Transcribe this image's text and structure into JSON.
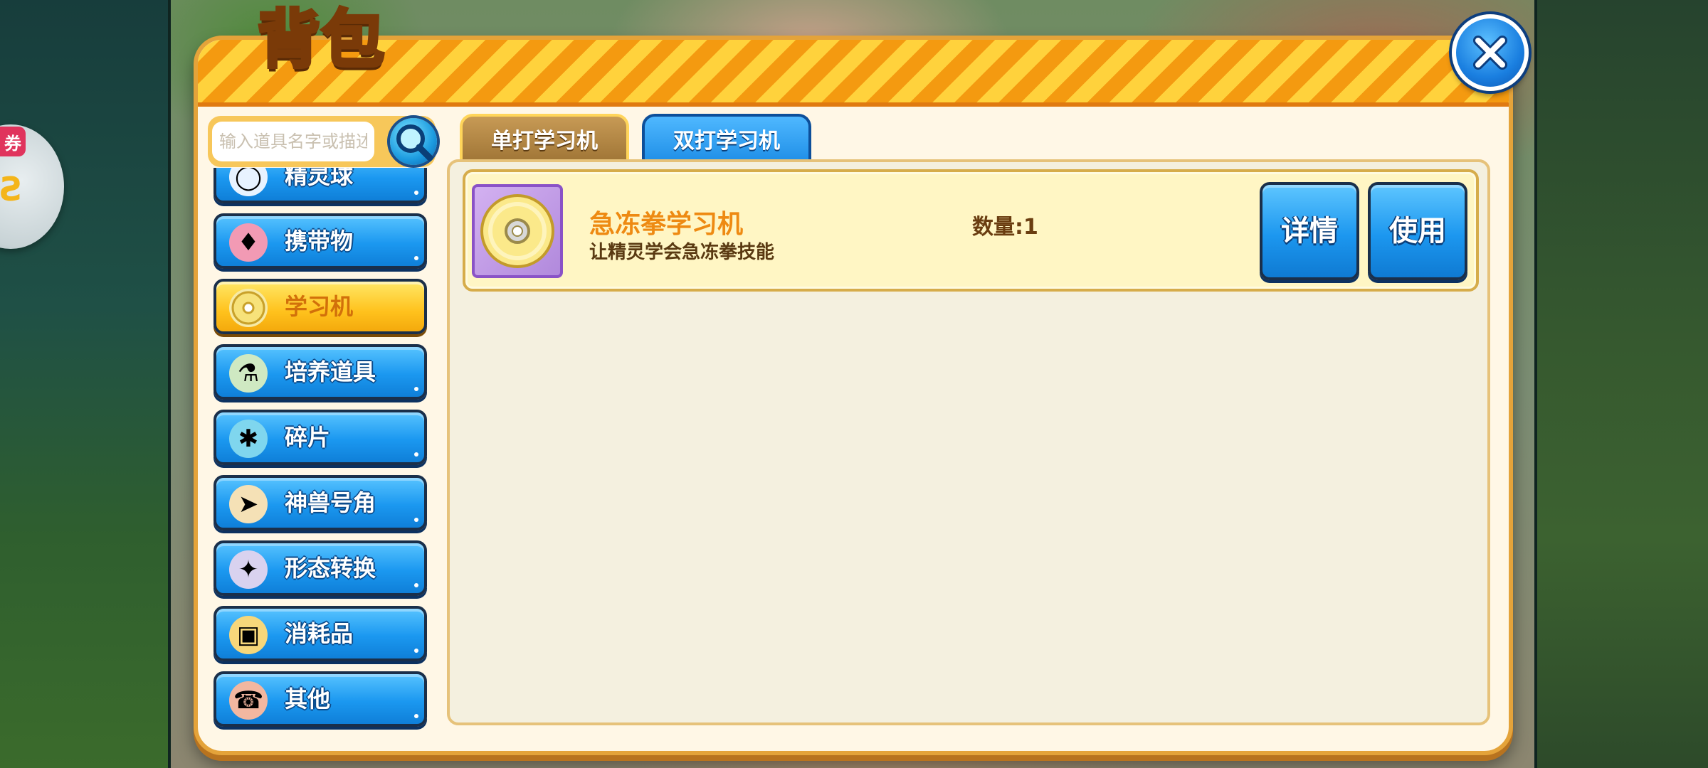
{
  "coupon": {
    "tag": "券"
  },
  "title": "背包",
  "search": {
    "placeholder": "输入道具名字或描述"
  },
  "categories": [
    {
      "label": "精灵球",
      "icon": "pokeball-icon",
      "active": false
    },
    {
      "label": "携带物",
      "icon": "held-item-icon",
      "active": false
    },
    {
      "label": "学习机",
      "icon": "disc-icon",
      "active": true
    },
    {
      "label": "培养道具",
      "icon": "training-item-icon",
      "active": false
    },
    {
      "label": "碎片",
      "icon": "puzzle-piece-icon",
      "active": false
    },
    {
      "label": "神兽号角",
      "icon": "horn-icon",
      "active": false
    },
    {
      "label": "形态转换",
      "icon": "transform-icon",
      "active": false
    },
    {
      "label": "消耗品",
      "icon": "chest-icon",
      "active": false
    },
    {
      "label": "其他",
      "icon": "megaphone-icon",
      "active": false
    }
  ],
  "tabs": [
    {
      "label": "单打学习机",
      "active": true
    },
    {
      "label": "双打学习机",
      "active": false
    }
  ],
  "items": [
    {
      "name": "急冻拳学习机",
      "description": "让精灵学会急冻拳技能",
      "quantity": "数量:1",
      "detail_label": "详情",
      "use_label": "使用"
    }
  ],
  "colors": {
    "header_stripe_a": "#ffd23c",
    "header_stripe_b": "#f49a10",
    "button_blue": "#1b98f0",
    "active_yellow": "#ffc21d",
    "item_name_orange": "#ee8a12"
  }
}
